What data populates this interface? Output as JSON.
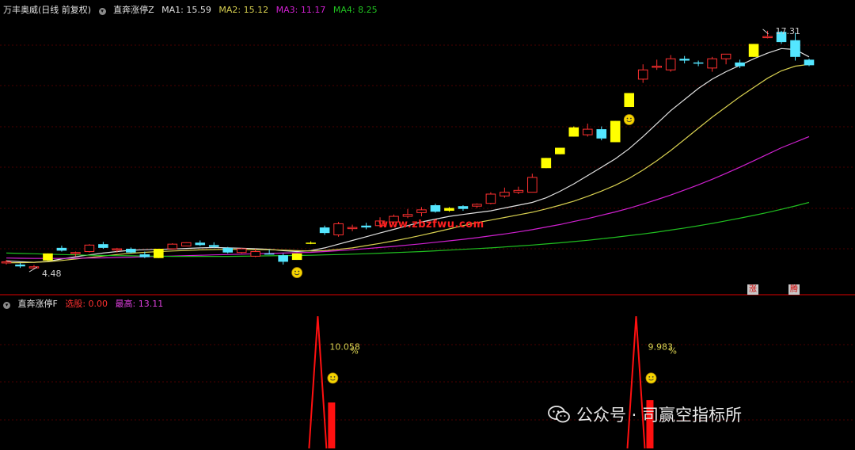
{
  "header_top": {
    "stock": "万丰奥威(日线 前复权)",
    "indicator": "直奔涨停Z",
    "ma1_label": "MA1:",
    "ma1_value": "15.59",
    "ma2_label": "MA2:",
    "ma2_value": "15.12",
    "ma3_label": "MA3:",
    "ma3_value": "11.17",
    "ma4_label": "MA4:",
    "ma4_value": "8.25"
  },
  "header_bottom": {
    "indicator": "直奔涨停F",
    "select_label": "选股:",
    "select_value": "0.00",
    "high_label": "最高:",
    "high_value": "13.11"
  },
  "annotations": {
    "price_high": "17.31",
    "price_low": "4.48",
    "badge_zhang": "涨",
    "badge_teng": "腾",
    "pct1": "10.058",
    "pct1_unit": "%",
    "pct2": "9.983",
    "pct2_unit": "%",
    "site": "www.zbzfwu.com"
  },
  "watermark": {
    "text": "公众号 · 司赢空指标所",
    "icon": "wechat-icon"
  },
  "colors": {
    "up": "#ff3030",
    "down": "#54e6ff",
    "signal": "#ffff00",
    "ma1": "#e0e0e0",
    "ma2": "#d8d050",
    "ma3": "#d020d0",
    "ma4": "#20c020",
    "bar": "#ff1010",
    "grid": "#5a0000"
  },
  "chart_data": [
    {
      "type": "candlestick",
      "title": "万丰奥威(日线 前复权)",
      "ylim": [
        3.5,
        18.2
      ],
      "low_label": 4.48,
      "high_label": 17.31,
      "candles": [
        {
          "o": 4.85,
          "h": 4.95,
          "l": 4.7,
          "c": 4.8,
          "k": "up"
        },
        {
          "o": 4.7,
          "h": 4.78,
          "l": 4.52,
          "c": 4.6,
          "k": "down"
        },
        {
          "o": 4.58,
          "h": 4.68,
          "l": 4.48,
          "c": 4.55,
          "k": "up"
        },
        {
          "o": 4.92,
          "h": 5.3,
          "l": 4.9,
          "c": 5.3,
          "k": "sig"
        },
        {
          "o": 5.6,
          "h": 5.72,
          "l": 5.4,
          "c": 5.45,
          "k": "down"
        },
        {
          "o": 5.3,
          "h": 5.4,
          "l": 5.15,
          "c": 5.35,
          "k": "up"
        },
        {
          "o": 5.4,
          "h": 5.8,
          "l": 5.35,
          "c": 5.75,
          "k": "up"
        },
        {
          "o": 5.8,
          "h": 5.92,
          "l": 5.55,
          "c": 5.6,
          "k": "down"
        },
        {
          "o": 5.5,
          "h": 5.6,
          "l": 5.35,
          "c": 5.55,
          "k": "up"
        },
        {
          "o": 5.55,
          "h": 5.62,
          "l": 5.3,
          "c": 5.35,
          "k": "down"
        },
        {
          "o": 5.25,
          "h": 5.4,
          "l": 5.05,
          "c": 5.1,
          "k": "down"
        },
        {
          "o": 5.05,
          "h": 5.55,
          "l": 5.05,
          "c": 5.55,
          "k": "sig"
        },
        {
          "o": 5.55,
          "h": 5.85,
          "l": 5.5,
          "c": 5.8,
          "k": "up"
        },
        {
          "o": 5.7,
          "h": 5.9,
          "l": 5.68,
          "c": 5.88,
          "k": "up"
        },
        {
          "o": 5.88,
          "h": 6.0,
          "l": 5.7,
          "c": 5.75,
          "k": "down"
        },
        {
          "o": 5.75,
          "h": 5.9,
          "l": 5.6,
          "c": 5.65,
          "k": "down"
        },
        {
          "o": 5.6,
          "h": 5.65,
          "l": 5.3,
          "c": 5.35,
          "k": "down"
        },
        {
          "o": 5.35,
          "h": 5.6,
          "l": 5.3,
          "c": 5.55,
          "k": "up"
        },
        {
          "o": 5.4,
          "h": 5.55,
          "l": 5.1,
          "c": 5.15,
          "k": "up"
        },
        {
          "o": 5.3,
          "h": 5.5,
          "l": 5.25,
          "c": 5.3,
          "k": "down"
        },
        {
          "o": 5.2,
          "h": 5.3,
          "l": 4.7,
          "c": 4.85,
          "k": "down"
        },
        {
          "o": 4.95,
          "h": 5.3,
          "l": 4.95,
          "c": 5.3,
          "k": "sig"
        },
        {
          "o": 5.85,
          "h": 5.95,
          "l": 5.8,
          "c": 5.88,
          "k": "sig"
        },
        {
          "o": 6.4,
          "h": 6.8,
          "l": 6.3,
          "c": 6.7,
          "k": "down"
        },
        {
          "o": 6.3,
          "h": 7.0,
          "l": 6.2,
          "c": 6.9,
          "k": "up"
        },
        {
          "o": 6.7,
          "h": 6.85,
          "l": 6.5,
          "c": 6.65,
          "k": "up"
        },
        {
          "o": 6.7,
          "h": 6.95,
          "l": 6.6,
          "c": 6.8,
          "k": "down"
        },
        {
          "o": 6.8,
          "h": 7.25,
          "l": 6.7,
          "c": 7.05,
          "k": "up"
        },
        {
          "o": 7.0,
          "h": 7.4,
          "l": 6.9,
          "c": 7.3,
          "k": "up"
        },
        {
          "o": 7.4,
          "h": 7.7,
          "l": 7.2,
          "c": 7.3,
          "k": "up"
        },
        {
          "o": 7.5,
          "h": 7.8,
          "l": 7.3,
          "c": 7.65,
          "k": "up"
        },
        {
          "o": 7.9,
          "h": 7.98,
          "l": 7.5,
          "c": 7.55,
          "k": "down"
        },
        {
          "o": 7.6,
          "h": 7.8,
          "l": 7.55,
          "c": 7.75,
          "k": "sig"
        },
        {
          "o": 7.7,
          "h": 7.9,
          "l": 7.6,
          "c": 7.85,
          "k": "down"
        },
        {
          "o": 7.85,
          "h": 8.0,
          "l": 7.75,
          "c": 7.95,
          "k": "up"
        },
        {
          "o": 8.0,
          "h": 8.6,
          "l": 7.95,
          "c": 8.5,
          "k": "up"
        },
        {
          "o": 8.4,
          "h": 8.85,
          "l": 8.3,
          "c": 8.6,
          "k": "up"
        },
        {
          "o": 8.6,
          "h": 8.9,
          "l": 8.5,
          "c": 8.7,
          "k": "up"
        },
        {
          "o": 8.6,
          "h": 9.6,
          "l": 8.6,
          "c": 9.4,
          "k": "up"
        },
        {
          "o": 9.9,
          "h": 10.45,
          "l": 9.9,
          "c": 10.45,
          "k": "sig"
        },
        {
          "o": 10.65,
          "h": 11.0,
          "l": 10.65,
          "c": 11.0,
          "k": "sig"
        },
        {
          "o": 11.6,
          "h": 12.15,
          "l": 11.6,
          "c": 12.1,
          "k": "sig"
        },
        {
          "o": 11.7,
          "h": 12.3,
          "l": 11.6,
          "c": 12.0,
          "k": "up"
        },
        {
          "o": 12.0,
          "h": 12.15,
          "l": 11.4,
          "c": 11.5,
          "k": "down"
        },
        {
          "o": 11.3,
          "h": 12.45,
          "l": 11.3,
          "c": 12.45,
          "k": "sig"
        },
        {
          "o": 13.2,
          "h": 13.95,
          "l": 13.2,
          "c": 13.95,
          "k": "sig"
        },
        {
          "o": 14.7,
          "h": 15.5,
          "l": 14.5,
          "c": 15.2,
          "k": "up"
        },
        {
          "o": 15.35,
          "h": 15.75,
          "l": 15.2,
          "c": 15.4,
          "k": "up"
        },
        {
          "o": 15.2,
          "h": 16.0,
          "l": 15.1,
          "c": 15.8,
          "k": "up"
        },
        {
          "o": 15.8,
          "h": 15.95,
          "l": 15.55,
          "c": 15.7,
          "k": "down"
        },
        {
          "o": 15.6,
          "h": 15.7,
          "l": 15.4,
          "c": 15.55,
          "k": "down"
        },
        {
          "o": 15.3,
          "h": 15.9,
          "l": 15.1,
          "c": 15.8,
          "k": "up"
        },
        {
          "o": 15.8,
          "h": 16.0,
          "l": 15.5,
          "c": 16.05,
          "k": "up"
        },
        {
          "o": 15.6,
          "h": 15.75,
          "l": 15.3,
          "c": 15.4,
          "k": "down"
        },
        {
          "o": 15.9,
          "h": 16.6,
          "l": 15.9,
          "c": 16.6,
          "k": "sig"
        },
        {
          "o": 17.0,
          "h": 17.31,
          "l": 16.9,
          "c": 16.95,
          "k": "up"
        },
        {
          "o": 17.25,
          "h": 17.31,
          "l": 16.6,
          "c": 16.7,
          "k": "down"
        },
        {
          "o": 16.8,
          "h": 17.2,
          "l": 15.7,
          "c": 15.9,
          "k": "down"
        },
        {
          "o": 15.75,
          "h": 15.8,
          "l": 15.4,
          "c": 15.45,
          "k": "down"
        }
      ],
      "series": [
        {
          "name": "MA1",
          "values": [
            4.9,
            4.85,
            4.82,
            4.87,
            5.0,
            5.12,
            5.22,
            5.32,
            5.4,
            5.47,
            5.5,
            5.52,
            5.54,
            5.57,
            5.6,
            5.62,
            5.6,
            5.58,
            5.55,
            5.52,
            5.45,
            5.4,
            5.45,
            5.6,
            5.8,
            6.0,
            6.2,
            6.4,
            6.6,
            6.8,
            7.0,
            7.15,
            7.3,
            7.4,
            7.5,
            7.6,
            7.75,
            7.9,
            8.05,
            8.3,
            8.65,
            9.05,
            9.5,
            9.95,
            10.4,
            10.95,
            11.6,
            12.3,
            13.0,
            13.6,
            14.2,
            14.7,
            15.1,
            15.45,
            15.8,
            16.1,
            16.35,
            16.3,
            15.9
          ]
        },
        {
          "name": "MA2",
          "values": [
            4.8,
            4.8,
            4.82,
            4.85,
            4.92,
            5.0,
            5.08,
            5.16,
            5.24,
            5.31,
            5.36,
            5.4,
            5.43,
            5.46,
            5.49,
            5.51,
            5.52,
            5.52,
            5.51,
            5.5,
            5.48,
            5.45,
            5.43,
            5.45,
            5.52,
            5.6,
            5.72,
            5.84,
            5.98,
            6.12,
            6.28,
            6.45,
            6.62,
            6.8,
            6.96,
            7.1,
            7.24,
            7.38,
            7.52,
            7.7,
            7.9,
            8.12,
            8.38,
            8.66,
            8.98,
            9.35,
            9.8,
            10.3,
            10.85,
            11.45,
            12.05,
            12.65,
            13.2,
            13.75,
            14.25,
            14.75,
            15.15,
            15.4,
            15.5
          ]
        },
        {
          "name": "MA3",
          "values": [
            5.05,
            5.04,
            5.03,
            5.03,
            5.03,
            5.04,
            5.05,
            5.06,
            5.08,
            5.1,
            5.12,
            5.14,
            5.16,
            5.18,
            5.2,
            5.22,
            5.24,
            5.26,
            5.28,
            5.3,
            5.32,
            5.34,
            5.36,
            5.4,
            5.45,
            5.5,
            5.56,
            5.62,
            5.68,
            5.75,
            5.82,
            5.9,
            5.98,
            6.06,
            6.15,
            6.25,
            6.35,
            6.46,
            6.58,
            6.72,
            6.86,
            7.02,
            7.18,
            7.36,
            7.54,
            7.74,
            7.96,
            8.2,
            8.45,
            8.72,
            9.0,
            9.3,
            9.62,
            9.95,
            10.3,
            10.65,
            11.0,
            11.3,
            11.6
          ]
        },
        {
          "name": "MA4",
          "values": [
            5.32,
            5.3,
            5.28,
            5.26,
            5.24,
            5.22,
            5.2,
            5.19,
            5.18,
            5.17,
            5.16,
            5.15,
            5.14,
            5.14,
            5.14,
            5.14,
            5.14,
            5.15,
            5.16,
            5.17,
            5.18,
            5.19,
            5.2,
            5.22,
            5.24,
            5.26,
            5.28,
            5.31,
            5.34,
            5.37,
            5.4,
            5.44,
            5.48,
            5.52,
            5.56,
            5.6,
            5.65,
            5.7,
            5.75,
            5.81,
            5.87,
            5.94,
            6.01,
            6.09,
            6.17,
            6.26,
            6.35,
            6.45,
            6.56,
            6.67,
            6.79,
            6.92,
            7.06,
            7.2,
            7.35,
            7.51,
            7.68,
            7.86,
            8.05
          ]
        }
      ],
      "signal_markers_at": [
        21,
        45
      ]
    },
    {
      "type": "indicator",
      "title": "直奔涨停F",
      "ylim": [
        0,
        12
      ],
      "spikes": [
        {
          "at": 22.5,
          "peak": 11.5,
          "base": 0,
          "label": "10.058%",
          "bar_value": 4.0
        },
        {
          "at": 45.5,
          "peak": 11.5,
          "base": 0,
          "label": "9.983%",
          "bar_value": 4.2
        }
      ]
    }
  ]
}
